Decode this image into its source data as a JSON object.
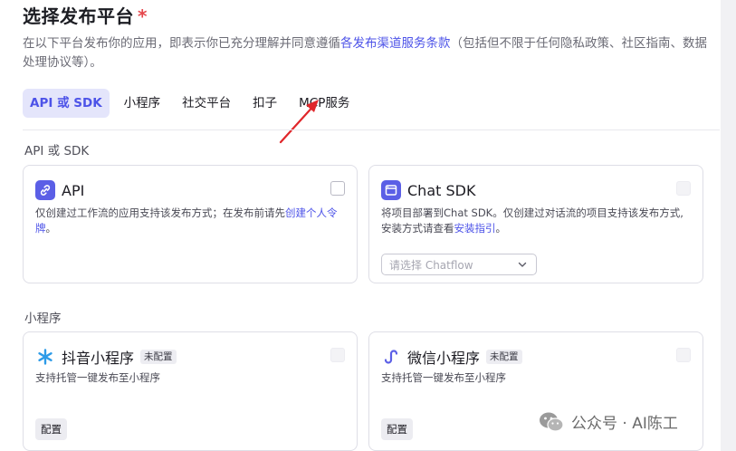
{
  "header": {
    "title": "选择发布平台",
    "required_mark": "*",
    "description_prefix": "在以下平台发布你的应用，即表示你已充分理解并同意遵循",
    "description_link": "各发布渠道服务条款",
    "description_suffix": "（包括但不限于任何隐私政策、社区指南、数据处理协议等）。"
  },
  "tabs": [
    {
      "label": "API 或 SDK",
      "active": true
    },
    {
      "label": "小程序",
      "active": false
    },
    {
      "label": "社交平台",
      "active": false
    },
    {
      "label": "扣子",
      "active": false
    },
    {
      "label": "MCP服务",
      "active": false
    }
  ],
  "sections": {
    "api_sdk": {
      "label": "API 或 SDK",
      "cards": [
        {
          "title": "API",
          "desc_prefix": "仅创建过工作流的应用支持该发布方式；在发布前请先",
          "desc_link": "创建个人令牌",
          "desc_suffix": "。"
        },
        {
          "title": "Chat SDK",
          "desc_prefix": "将项目部署到Chat SDK。仅创建过对话流的项目支持该发布方式,安装方式请查看",
          "desc_link": "安装指引",
          "desc_suffix": "。",
          "select_placeholder": "请选择 Chatflow"
        }
      ]
    },
    "mini_program": {
      "label": "小程序",
      "cards": [
        {
          "title": "抖音小程序",
          "badge": "未配置",
          "desc": "支持托管一键发布至小程序",
          "button": "配置"
        },
        {
          "title": "微信小程序",
          "badge": "未配置",
          "desc": "支持托管一键发布至小程序",
          "button": "配置"
        }
      ]
    }
  },
  "watermark": {
    "text": "公众号 · AI陈工"
  },
  "colors": {
    "accent": "#4d53e8",
    "required": "#e5484d",
    "arrow": "#e0262a"
  }
}
